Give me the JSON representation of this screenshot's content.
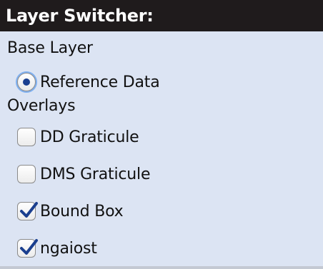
{
  "header": {
    "title": "Layer Switcher:"
  },
  "base_layer": {
    "label": "Base Layer",
    "items": [
      {
        "label": "Reference Data",
        "selected": true
      }
    ]
  },
  "overlays": {
    "label": "Overlays",
    "items": [
      {
        "label": "DD Graticule",
        "checked": false
      },
      {
        "label": "DMS Graticule",
        "checked": false
      },
      {
        "label": "Bound Box",
        "checked": true
      },
      {
        "label": "ngaiost",
        "checked": true
      }
    ]
  },
  "colors": {
    "header_bg": "#1f1b1c",
    "panel_bg": "#dce4f3",
    "check_color": "#1a3f8f"
  }
}
